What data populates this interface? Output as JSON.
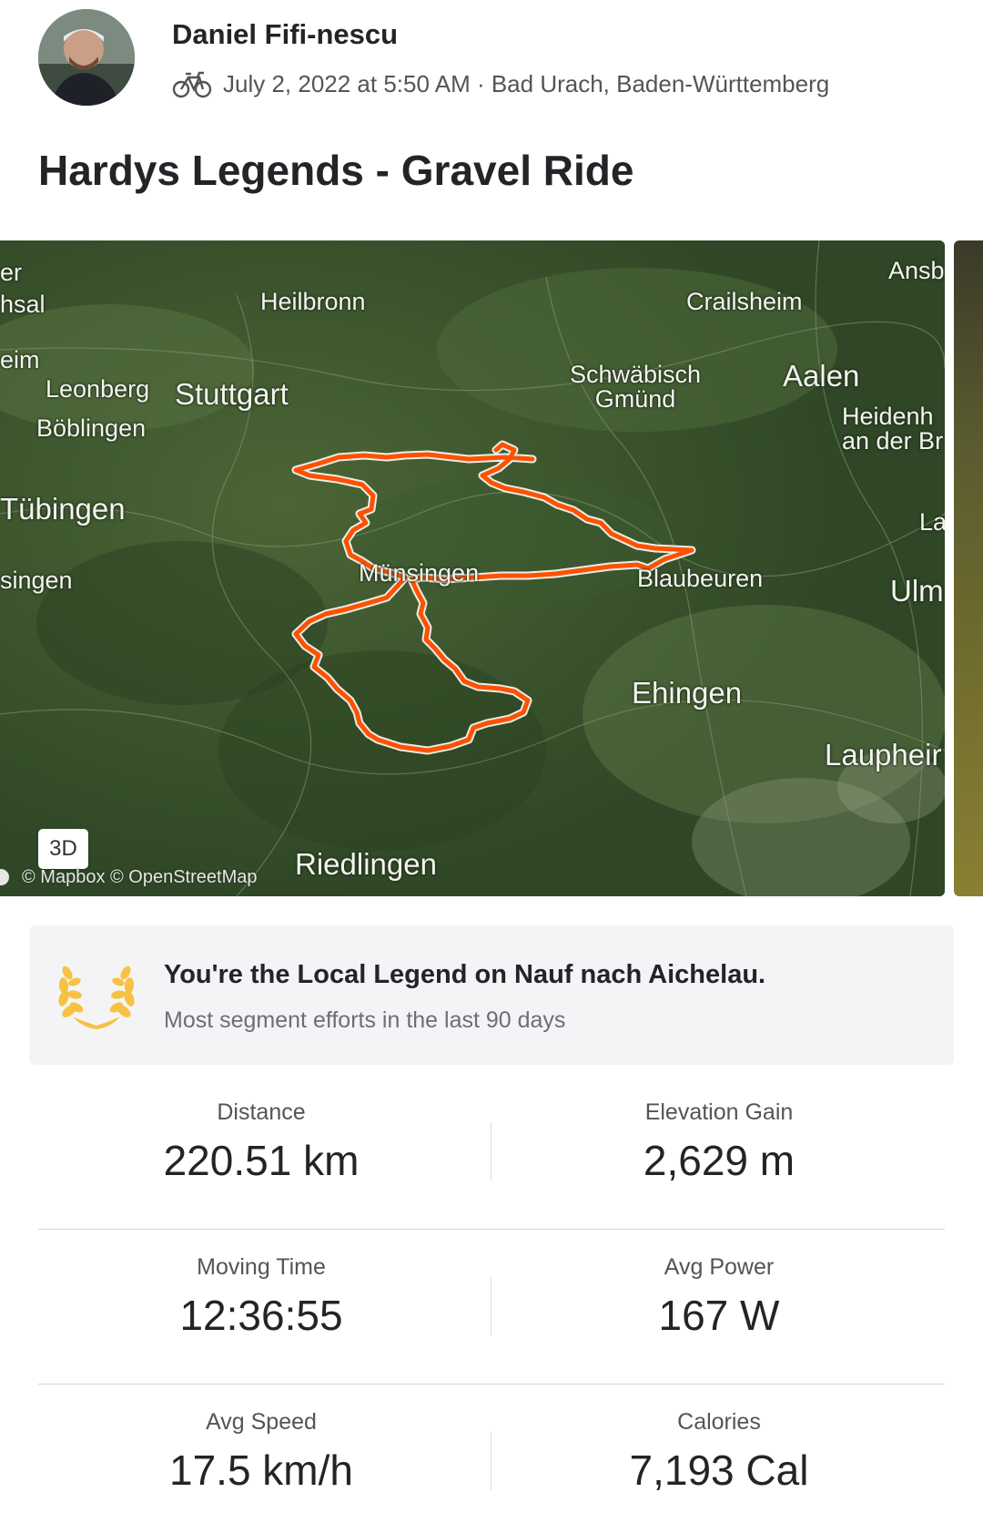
{
  "header": {
    "athlete_name": "Daniel Fifi-nescu",
    "date_location": "July 2, 2022 at 5:50 AM · Bad Urach, Baden-Württemberg",
    "activity_type_icon": "bike-icon"
  },
  "activity": {
    "title": "Hardys Legends - Gravel Ride"
  },
  "map": {
    "labels": {
      "heilbronn": "Heilbronn",
      "crailsheim": "Crailsheim",
      "ansbach": "Ansb",
      "bruchsal": "hsal",
      "er": "er",
      "eim": "eim",
      "leonberg": "Leonberg",
      "boblingen": "Böblingen",
      "stuttgart": "Stuttgart",
      "schwabisch_gmund": "Schwäbisch\nGmünd",
      "aalen": "Aalen",
      "heidenheim": "Heidenh\nan der Br",
      "tubingen": "Tübingen",
      "la": "La",
      "singen": "singen",
      "munsingen": "Münsingen",
      "blaubeuren": "Blaubeuren",
      "ulm": "Ulm",
      "ehingen": "Ehingen",
      "laupheim": "Laupheir",
      "riedlingen": "Riedlingen"
    },
    "view_mode_button": "3D",
    "attribution": "© Mapbox © OpenStreetMap",
    "route_color": "#fc5200"
  },
  "local_legend": {
    "title": "You're the Local Legend on Nauf nach Aichelau.",
    "subtitle": "Most segment efforts in the last 90 days",
    "icon": "laurel-icon",
    "icon_color": "#f7c244"
  },
  "stats": {
    "distance": {
      "label": "Distance",
      "value": "220.51 km"
    },
    "elevation_gain": {
      "label": "Elevation Gain",
      "value": "2,629 m"
    },
    "moving_time": {
      "label": "Moving Time",
      "value": "12:36:55"
    },
    "avg_power": {
      "label": "Avg Power",
      "value": "167 W"
    },
    "avg_speed": {
      "label": "Avg Speed",
      "value": "17.5 km/h"
    },
    "calories": {
      "label": "Calories",
      "value": "7,193 Cal"
    }
  }
}
